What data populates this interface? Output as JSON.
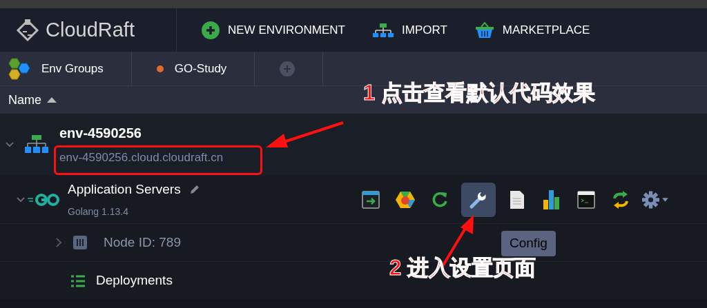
{
  "header": {
    "logo": "CloudRaft",
    "actions": [
      {
        "kind": "new",
        "label": "NEW ENVIRONMENT"
      },
      {
        "kind": "import",
        "label": "IMPORT"
      },
      {
        "kind": "marketplace",
        "label": "MARKETPLACE"
      }
    ]
  },
  "breadcrumbs": [
    {
      "kind": "groups",
      "label": "Env Groups"
    },
    {
      "kind": "group",
      "label": "GO-Study",
      "color": "#e06a2c"
    },
    {
      "kind": "add"
    }
  ],
  "column_header": {
    "label": "Name",
    "sort_ascending": true
  },
  "environment": {
    "name": "env-4590256",
    "url": "env-4590256.cloud.cloudraft.cn",
    "expanded": true
  },
  "node_group": {
    "name": "Application Servers",
    "version": "Golang 1.13.4",
    "expanded": true,
    "toolbar": [
      {
        "kind": "open",
        "selected": false
      },
      {
        "kind": "addons",
        "selected": false
      },
      {
        "kind": "restart",
        "selected": false
      },
      {
        "kind": "config",
        "selected": true
      },
      {
        "kind": "logs",
        "selected": false
      },
      {
        "kind": "stats",
        "selected": false
      },
      {
        "kind": "terminal",
        "selected": false
      },
      {
        "kind": "redeploy",
        "selected": false
      },
      {
        "kind": "settings",
        "selected": false
      }
    ],
    "tooltip": "Config"
  },
  "rows": [
    {
      "kind": "node",
      "label": "Node ID: 789",
      "expanded": false
    },
    {
      "kind": "deployments",
      "label": "Deployments"
    }
  ],
  "annotations": [
    "1 点击查看默认代码效果",
    "2 进入设置页面"
  ]
}
